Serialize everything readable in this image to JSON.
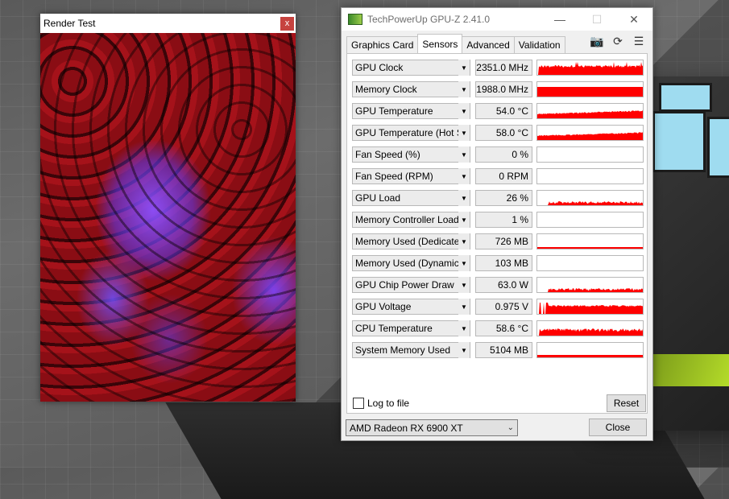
{
  "render_test": {
    "title": "Render Test",
    "close_label": "x"
  },
  "gpuz": {
    "title": "TechPowerUp GPU-Z 2.41.0",
    "tabs": [
      {
        "label": "Graphics Card",
        "active": false
      },
      {
        "label": "Sensors",
        "active": true
      },
      {
        "label": "Advanced",
        "active": false
      },
      {
        "label": "Validation",
        "active": false
      }
    ],
    "toolbar_icons": [
      "camera-icon",
      "refresh-icon",
      "menu-icon"
    ],
    "sensor_color": "#ff0000",
    "sensors": [
      {
        "name": "GPU Clock",
        "value": "2351.0 MHz",
        "graph": "spiky-high"
      },
      {
        "name": "Memory Clock",
        "value": "1988.0 MHz",
        "graph": "full"
      },
      {
        "name": "GPU Temperature",
        "value": "54.0 °C",
        "graph": "ramp-mid"
      },
      {
        "name": "GPU Temperature (Hot Spot)",
        "value": "58.0 °C",
        "graph": "ramp-mid"
      },
      {
        "name": "Fan Speed (%)",
        "value": "0 %",
        "graph": "none"
      },
      {
        "name": "Fan Speed (RPM)",
        "value": "0 RPM",
        "graph": "none"
      },
      {
        "name": "GPU Load",
        "value": "26 %",
        "graph": "low-noisy"
      },
      {
        "name": "Memory Controller Load",
        "value": "1 %",
        "graph": "none"
      },
      {
        "name": "Memory Used (Dedicated)",
        "value": "726 MB",
        "graph": "line-low"
      },
      {
        "name": "Memory Used (Dynamic)",
        "value": "103 MB",
        "graph": "none"
      },
      {
        "name": "GPU Chip Power Draw",
        "value": "63.0 W",
        "graph": "low-noisy"
      },
      {
        "name": "GPU Voltage",
        "value": "0.975 V",
        "graph": "mid-spiky"
      },
      {
        "name": "CPU Temperature",
        "value": "58.6 °C",
        "graph": "mid-noisy"
      },
      {
        "name": "System Memory Used",
        "value": "5104 MB",
        "graph": "line-low2"
      }
    ],
    "log_to_file_label": "Log to file",
    "log_to_file_checked": false,
    "reset_label": "Reset",
    "device_selected": "AMD Radeon RX 6900 XT",
    "close_label": "Close"
  }
}
